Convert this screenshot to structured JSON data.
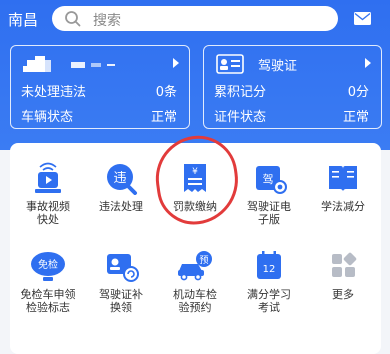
{
  "header": {
    "city": "南昌",
    "search_placeholder": "搜索"
  },
  "vehicle_card": {
    "rows": [
      {
        "label": "未处理违法",
        "value": "0条"
      },
      {
        "label": "车辆状态",
        "value": "正常"
      }
    ]
  },
  "license_card": {
    "title": "驾驶证",
    "rows": [
      {
        "label": "累积记分",
        "value": "0分"
      },
      {
        "label": "证件状态",
        "value": "正常"
      }
    ]
  },
  "services": [
    {
      "label1": "事故视频",
      "label2": "快处",
      "icon": "accident-video-icon"
    },
    {
      "label1": "违法处理",
      "label2": "",
      "icon": "violation-icon",
      "badge": "违"
    },
    {
      "label1": "罚款缴纳",
      "label2": "",
      "icon": "fine-payment-icon"
    },
    {
      "label1": "驾驶证电",
      "label2": "子版",
      "icon": "e-license-icon",
      "badge": "驾"
    },
    {
      "label1": "学法减分",
      "label2": "",
      "icon": "study-book-icon"
    },
    {
      "label1": "免检车申领",
      "label2": "检验标志",
      "icon": "exempt-inspection-icon",
      "badge": "免检"
    },
    {
      "label1": "驾驶证补",
      "label2": "换领",
      "icon": "license-renew-icon"
    },
    {
      "label1": "机动车检",
      "label2": "验预约",
      "icon": "inspection-booking-icon",
      "badge": "预"
    },
    {
      "label1": "满分学习",
      "label2": "考试",
      "icon": "calendar-exam-icon",
      "badge": "12"
    },
    {
      "label1": "更多",
      "label2": "",
      "icon": "more-grid-icon"
    }
  ],
  "colors": {
    "brand_blue": "#2f6ff0",
    "highlight_red": "#e23b3b"
  }
}
